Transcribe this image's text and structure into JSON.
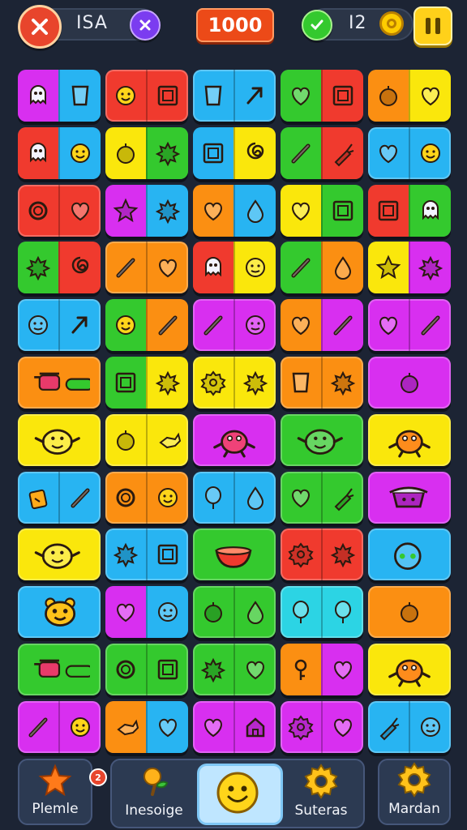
{
  "topbar": {
    "left_label": "ISA",
    "score": "1000",
    "right_label": "I2",
    "close_icon": "close-icon",
    "extra_icon": "x-icon",
    "check_icon": "check-icon",
    "coin_icon": "coin-icon",
    "pause_icon": "pause-icon"
  },
  "palette": {
    "M": "#d82ff0",
    "B": "#28b4f2",
    "R": "#f03a2e",
    "O": "#fb8f12",
    "G": "#34c92e",
    "Y": "#fae70c",
    "P": "#a233f0",
    "C": "#2cd4e4"
  },
  "tiles": [
    [
      {
        "c": [
          "M",
          "B"
        ],
        "i": [
          "ghost-icon",
          "cup-icon"
        ]
      },
      {
        "c": [
          "R"
        ],
        "i": [
          "smiley-icon",
          "square-icon"
        ]
      },
      {
        "c": [
          "B"
        ],
        "i": [
          "cup-icon",
          "arrow-icon"
        ]
      },
      {
        "c": [
          "G",
          "R"
        ],
        "i": [
          "heart-icon",
          "square-icon"
        ]
      },
      {
        "c": [
          "O",
          "Y"
        ],
        "i": [
          "apple-icon",
          "heart-icon"
        ]
      }
    ],
    [
      {
        "c": [
          "R",
          "B"
        ],
        "i": [
          "ghost-icon",
          "smiley-icon"
        ]
      },
      {
        "c": [
          "Y",
          "G"
        ],
        "i": [
          "apple-icon",
          "splat-icon"
        ]
      },
      {
        "c": [
          "B",
          "Y"
        ],
        "i": [
          "square-icon",
          "swirl-icon"
        ]
      },
      {
        "c": [
          "G",
          "R"
        ],
        "i": [
          "stick-icon",
          "carrot-icon"
        ]
      },
      {
        "c": [
          "B"
        ],
        "i": [
          "heart-icon",
          "smiley-icon"
        ]
      }
    ],
    [
      {
        "c": [
          "R"
        ],
        "i": [
          "ring-icon",
          "heart-icon"
        ]
      },
      {
        "c": [
          "M",
          "B"
        ],
        "i": [
          "star-icon",
          "splat-icon"
        ]
      },
      {
        "c": [
          "O",
          "B"
        ],
        "i": [
          "heart-icon",
          "drop-icon"
        ]
      },
      {
        "c": [
          "Y",
          "G"
        ],
        "i": [
          "heart-icon",
          "square-icon"
        ]
      },
      {
        "c": [
          "R",
          "G"
        ],
        "i": [
          "square-icon",
          "ghost-icon"
        ]
      }
    ],
    [
      {
        "c": [
          "G",
          "R"
        ],
        "i": [
          "splat-icon",
          "swirl-icon"
        ]
      },
      {
        "c": [
          "O"
        ],
        "i": [
          "stick-icon",
          "heart-icon"
        ]
      },
      {
        "c": [
          "R",
          "Y"
        ],
        "i": [
          "ghost-icon",
          "face-icon"
        ]
      },
      {
        "c": [
          "G",
          "O"
        ],
        "i": [
          "stick-icon",
          "drop-icon"
        ]
      },
      {
        "c": [
          "Y",
          "M"
        ],
        "i": [
          "star-icon",
          "splat-icon"
        ]
      }
    ],
    [
      {
        "c": [
          "B"
        ],
        "i": [
          "face-icon",
          "arrow-icon"
        ]
      },
      {
        "c": [
          "G",
          "O"
        ],
        "i": [
          "smiley-icon",
          "stick-icon"
        ]
      },
      {
        "c": [
          "M"
        ],
        "i": [
          "stick-icon",
          "face-icon"
        ]
      },
      {
        "c": [
          "O",
          "M"
        ],
        "i": [
          "heart-icon",
          "stick-icon"
        ]
      },
      {
        "c": [
          "M"
        ],
        "i": [
          "heart-icon",
          "stick-icon"
        ]
      }
    ],
    [
      {
        "c": [
          "O"
        ],
        "i": [
          "pot-icon"
        ]
      },
      {
        "c": [
          "G",
          "Y"
        ],
        "i": [
          "square-icon",
          "splat-icon"
        ]
      },
      {
        "c": [
          "Y"
        ],
        "i": [
          "gear-icon",
          "splat-icon"
        ]
      },
      {
        "c": [
          "O"
        ],
        "i": [
          "cup-icon",
          "splat-icon"
        ]
      },
      {
        "c": [
          "M"
        ],
        "i": [
          "apple-icon"
        ]
      }
    ],
    [
      {
        "c": [
          "Y"
        ],
        "i": [
          "fish-icon"
        ]
      },
      {
        "c": [
          "Y"
        ],
        "i": [
          "apple-icon",
          "bird-icon"
        ]
      },
      {
        "c": [
          "M"
        ],
        "i": [
          "crab-icon"
        ]
      },
      {
        "c": [
          "G"
        ],
        "i": [
          "fish-icon"
        ]
      },
      {
        "c": [
          "Y"
        ],
        "i": [
          "crab-icon"
        ]
      }
    ],
    [
      {
        "c": [
          "B"
        ],
        "i": [
          "bag-icon",
          "stick-icon"
        ]
      },
      {
        "c": [
          "O"
        ],
        "i": [
          "ring-icon",
          "smiley-icon"
        ]
      },
      {
        "c": [
          "B"
        ],
        "i": [
          "balloon-icon",
          "drop-icon"
        ]
      },
      {
        "c": [
          "G"
        ],
        "i": [
          "heart-icon",
          "carrot-icon"
        ]
      },
      {
        "c": [
          "M"
        ],
        "i": [
          "hat-icon"
        ]
      }
    ],
    [
      {
        "c": [
          "Y"
        ],
        "i": [
          "fish-icon"
        ]
      },
      {
        "c": [
          "B"
        ],
        "i": [
          "splat-icon",
          "square-icon"
        ]
      },
      {
        "c": [
          "G"
        ],
        "i": [
          "bowl-icon"
        ]
      },
      {
        "c": [
          "R"
        ],
        "i": [
          "gear-icon",
          "splat-icon"
        ]
      },
      {
        "c": [
          "B"
        ],
        "i": [
          "ball-icon"
        ]
      }
    ],
    [
      {
        "c": [
          "B"
        ],
        "i": [
          "bear-icon"
        ]
      },
      {
        "c": [
          "M",
          "B"
        ],
        "i": [
          "heart-icon",
          "face-icon"
        ]
      },
      {
        "c": [
          "G"
        ],
        "i": [
          "apple-icon",
          "drop-icon"
        ]
      },
      {
        "c": [
          "C"
        ],
        "i": [
          "balloon-icon",
          "balloon-icon"
        ]
      },
      {
        "c": [
          "O"
        ],
        "i": [
          "apple-icon"
        ]
      }
    ],
    [
      {
        "c": [
          "G"
        ],
        "i": [
          "pot-icon"
        ]
      },
      {
        "c": [
          "G"
        ],
        "i": [
          "ring-icon",
          "square-icon"
        ]
      },
      {
        "c": [
          "G"
        ],
        "i": [
          "splat-icon",
          "heart-icon"
        ]
      },
      {
        "c": [
          "O",
          "M"
        ],
        "i": [
          "key-icon",
          "heart-icon"
        ]
      },
      {
        "c": [
          "Y"
        ],
        "i": [
          "crab-icon"
        ]
      }
    ],
    [
      {
        "c": [
          "M"
        ],
        "i": [
          "stick-icon",
          "smiley-icon"
        ]
      },
      {
        "c": [
          "O",
          "B"
        ],
        "i": [
          "bird-icon",
          "heart-icon"
        ]
      },
      {
        "c": [
          "M"
        ],
        "i": [
          "heart-icon",
          "house-icon"
        ]
      },
      {
        "c": [
          "M"
        ],
        "i": [
          "gear-icon",
          "heart-icon"
        ]
      },
      {
        "c": [
          "B"
        ],
        "i": [
          "carrot-icon",
          "face-icon"
        ]
      }
    ]
  ],
  "nav": {
    "item1_label": "Plemle",
    "item1_badge": "2",
    "item2_label": "Inesoige",
    "item3_label": "Suteras",
    "item4_label": "Mardan",
    "item1_icon": "star-icon",
    "item2_icon": "plant-icon",
    "center_icon": "smiley-icon",
    "item3_icon": "gear-icon",
    "item4_icon": "gear-icon"
  }
}
